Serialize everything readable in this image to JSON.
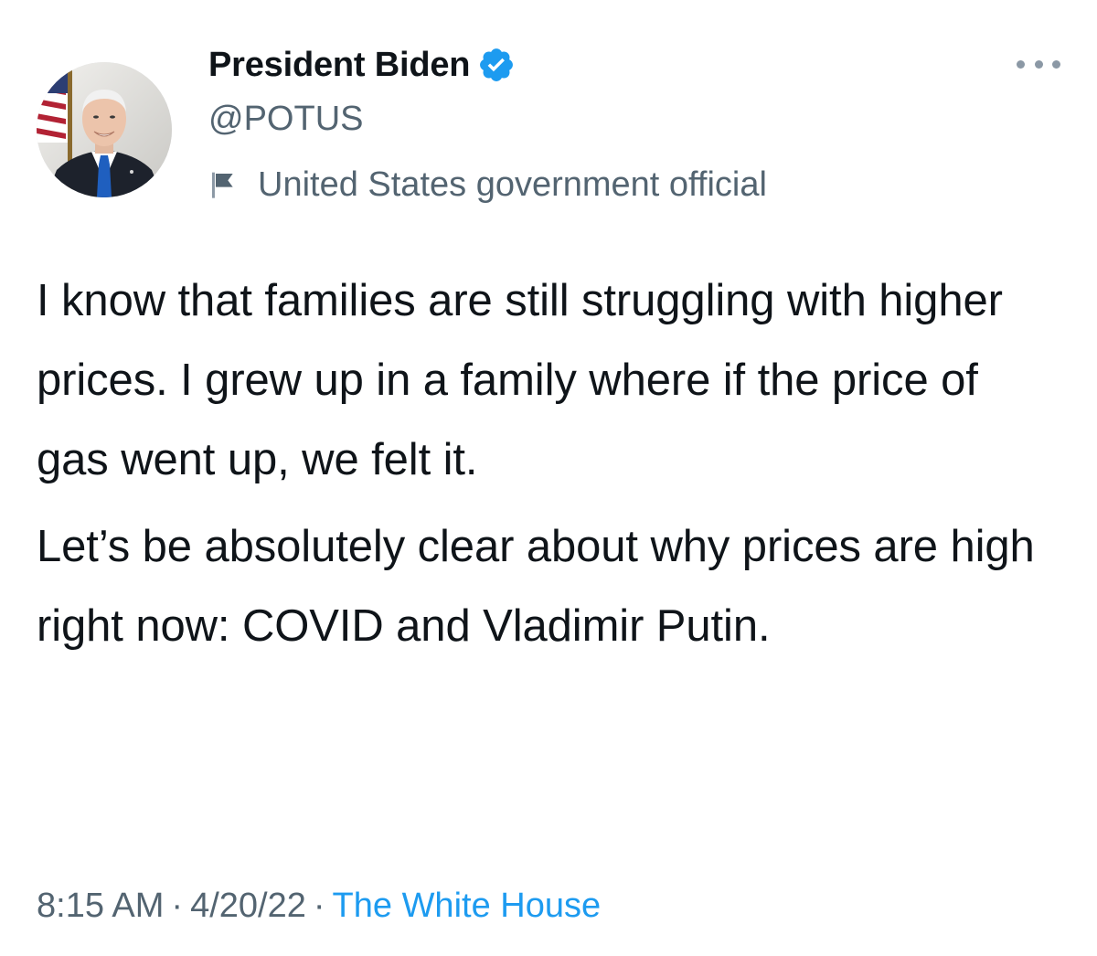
{
  "author": {
    "display_name": "President Biden",
    "handle": "@POTUS",
    "verified": true,
    "label": "United States government official",
    "avatar_icon": "profile-photo-icon"
  },
  "tweet": {
    "paragraphs": [
      "I know that families are still struggling with higher prices. I grew up in a family where if the price of gas went up, we felt it.",
      "Let’s be absolutely clear about why prices are high right now: COVID and Vladimir Putin."
    ],
    "time": "8:15 AM",
    "separator": "·",
    "date": "4/20/22",
    "source": "The White House"
  },
  "colors": {
    "text_primary": "#0f1419",
    "text_secondary": "#536471",
    "link_blue": "#1d9bf0",
    "verified_blue": "#1d9bf0"
  },
  "icons": {
    "more": "more-horizontal-icon",
    "verified": "verified-badge-icon",
    "label": "flag-icon"
  }
}
